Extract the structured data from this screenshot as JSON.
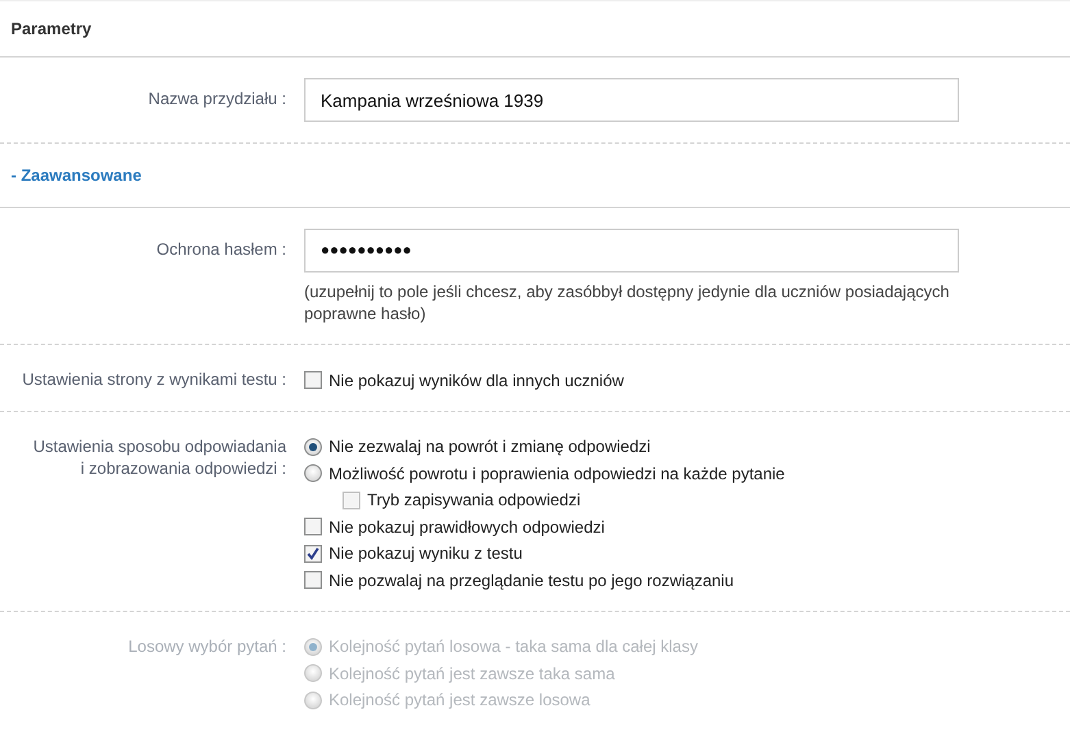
{
  "panel_title": "Parametry",
  "rows": [
    {
      "kind": "text",
      "label": "Nazwa przydziału :",
      "value": "Kampania wrześniowa 1939"
    }
  ],
  "advanced_toggle": "- Zaawansowane",
  "advanced_rows": [
    {
      "kind": "password",
      "label": "Ochrona hasłem :",
      "value": "●●●●●●●●●●",
      "hint": "(uzupełnij to pole jeśli chcesz, aby zasóbbył dostępny jedynie dla uczniów posiadających poprawne hasło)"
    },
    {
      "kind": "options",
      "label": "Ustawienia strony z wynikami testu :",
      "disabled": false,
      "options": [
        {
          "kind": "checkbox",
          "label": "Nie pokazuj wyników dla innych uczniów",
          "checked": false,
          "indented": false
        }
      ]
    },
    {
      "kind": "options",
      "label": "Ustawienia sposobu odpowiadania\ni zobrazowania odpowiedzi :",
      "disabled": false,
      "options": [
        {
          "kind": "radio",
          "label": "Nie zezwalaj na powrót i zmianę odpowiedzi",
          "selected": true,
          "indented": false
        },
        {
          "kind": "radio",
          "label": "Możliwość powrotu i poprawienia odpowiedzi na każde pytanie",
          "selected": false,
          "indented": false
        },
        {
          "kind": "checkbox",
          "label": "Tryb zapisywania odpowiedzi",
          "checked": false,
          "indented": true
        },
        {
          "kind": "checkbox",
          "label": "Nie pokazuj prawidłowych odpowiedzi",
          "checked": false,
          "indented": false
        },
        {
          "kind": "checkbox",
          "label": "Nie pokazuj wyniku z testu",
          "checked": true,
          "indented": false
        },
        {
          "kind": "checkbox",
          "label": "Nie pozwalaj na przeglądanie testu po jego rozwiązaniu",
          "checked": false,
          "indented": false
        }
      ]
    },
    {
      "kind": "options",
      "label": "Losowy wybór pytań :",
      "disabled": true,
      "options": [
        {
          "kind": "radio",
          "label": "Kolejność pytań losowa - taka sama dla całej klasy",
          "selected": true,
          "indented": false
        },
        {
          "kind": "radio",
          "label": "Kolejność pytań jest zawsze taka sama",
          "selected": false,
          "indented": false
        },
        {
          "kind": "radio",
          "label": "Kolejność pytań jest zawsze losowa",
          "selected": false,
          "indented": false
        }
      ]
    }
  ]
}
